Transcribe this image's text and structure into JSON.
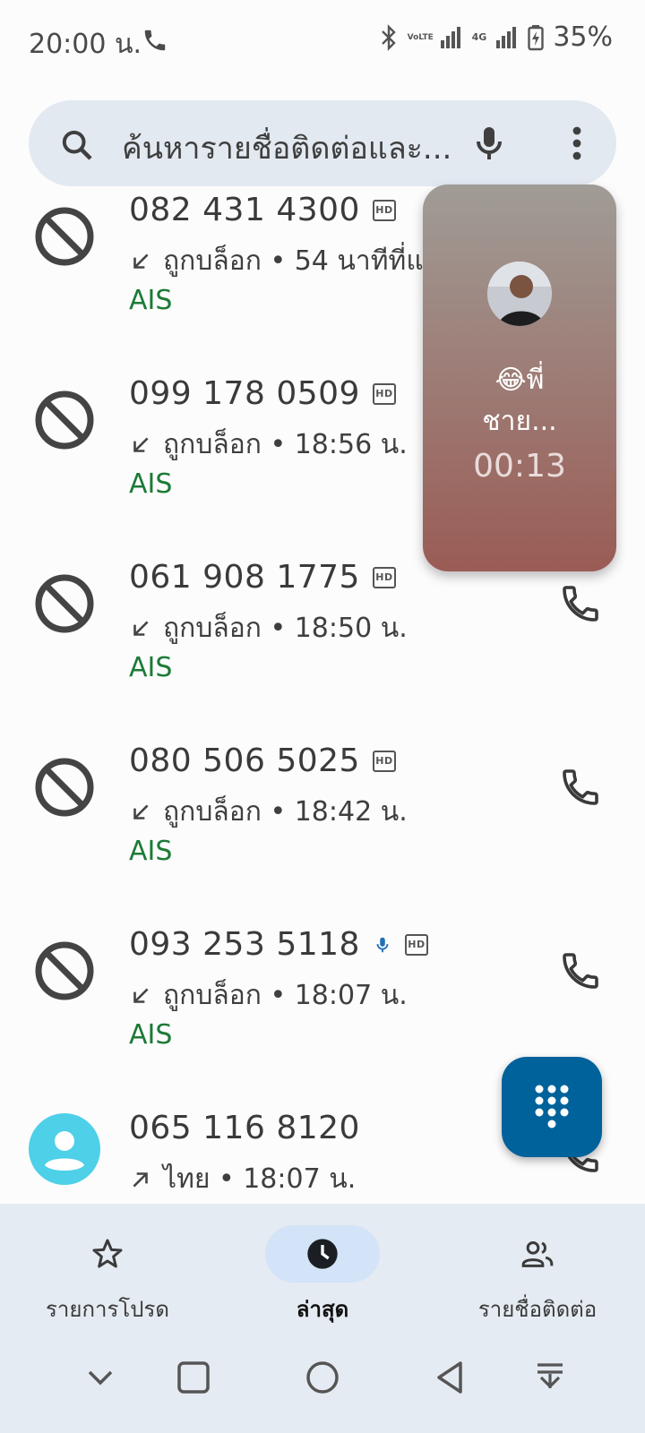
{
  "status_bar": {
    "time": "20:00 น.",
    "battery": "35%",
    "volte_label": "VoLTE",
    "network_label": "4G"
  },
  "search": {
    "placeholder": "ค้นหารายชื่อติดต่อและ..."
  },
  "calls": [
    {
      "number": "082 431 4300",
      "status": "ถูกบล็อก • 54 นาทีที่แล้ว",
      "carrier": "AIS",
      "blocked": true,
      "icons": [
        "hd-icon"
      ],
      "direction": "incoming"
    },
    {
      "number": "099 178 0509",
      "status": "ถูกบล็อก • 18:56 น.",
      "carrier": "AIS",
      "blocked": true,
      "icons": [
        "hd-icon"
      ],
      "direction": "incoming"
    },
    {
      "number": "061 908 1775",
      "status": "ถูกบล็อก • 18:50 น.",
      "carrier": "AIS",
      "blocked": true,
      "icons": [
        "hd-icon"
      ],
      "direction": "incoming"
    },
    {
      "number": "080 506 5025",
      "status": "ถูกบล็อก • 18:42 น.",
      "carrier": "AIS",
      "blocked": true,
      "icons": [
        "hd-icon"
      ],
      "direction": "incoming"
    },
    {
      "number": "093 253 5118",
      "status": "ถูกบล็อก • 18:07 น.",
      "carrier": "AIS",
      "blocked": true,
      "icons": [
        "mic-icon",
        "hd-icon"
      ],
      "direction": "incoming"
    },
    {
      "number": "065 116 8120",
      "status": "ไทย • 18:07 น.",
      "carrier": "",
      "blocked": false,
      "icons": [],
      "direction": "outgoing"
    }
  ],
  "bubble": {
    "name_line1": "😂พี่",
    "name_line2": "ชาย...",
    "timer": "00:13"
  },
  "bottom_nav": {
    "tabs": [
      {
        "label": "รายการโปรด",
        "icon": "star-icon",
        "active": false
      },
      {
        "label": "ล่าสุด",
        "icon": "clock-icon",
        "active": true
      },
      {
        "label": "รายชื่อติดต่อ",
        "icon": "people-icon",
        "active": false
      }
    ]
  },
  "colors": {
    "carrier": "#1c7a36",
    "fab": "#00629b",
    "nav_bg": "#e5ebf2",
    "active_pill": "#d3e3f8"
  }
}
